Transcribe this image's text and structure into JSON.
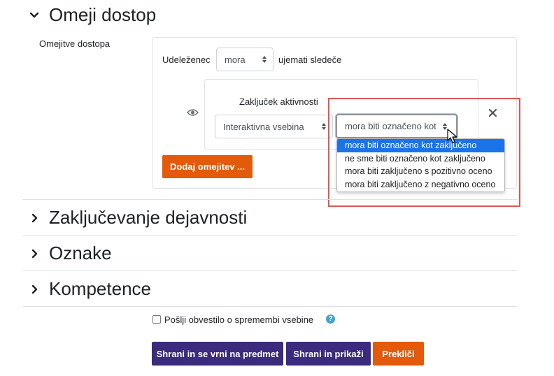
{
  "sections": {
    "restrict": {
      "title": "Omeji dostop"
    },
    "completion": {
      "title": "Zaključevanje dejavnosti"
    },
    "tags": {
      "title": "Oznake"
    },
    "competencies": {
      "title": "Kompetence"
    }
  },
  "restrict_access": {
    "label": "Omejitve dostopa",
    "student_label": "Udeleženec",
    "must_select": {
      "value": "mora"
    },
    "match_text": "ujemati sledeče",
    "condition": {
      "type_label": "Zaključek aktivnosti",
      "activity_select": {
        "value": "Interaktivna vsebina"
      },
      "status_select": {
        "value": "mora biti označeno kot zaključeno",
        "options": [
          "mora biti označeno kot zaključeno",
          "ne sme biti označeno kot zaključeno",
          "mora biti zaključeno s pozitivno oceno",
          "mora biti zaključeno z negativno oceno"
        ],
        "selected_index": 0
      }
    },
    "add_button": "Dodaj omejitev ..."
  },
  "notify": {
    "label": "Pošlji obvestilo o spremembi vsebine",
    "checked": false
  },
  "actions": {
    "save_return": "Shrani in se vrni na predmet",
    "save_display": "Shrani in prikaži",
    "cancel": "Prekliči"
  },
  "colors": {
    "accent_orange": "#e35a0b",
    "primary_purple": "#3b2a7d",
    "highlight_red": "#e05555",
    "dropdown_selected": "#1a73e8"
  }
}
